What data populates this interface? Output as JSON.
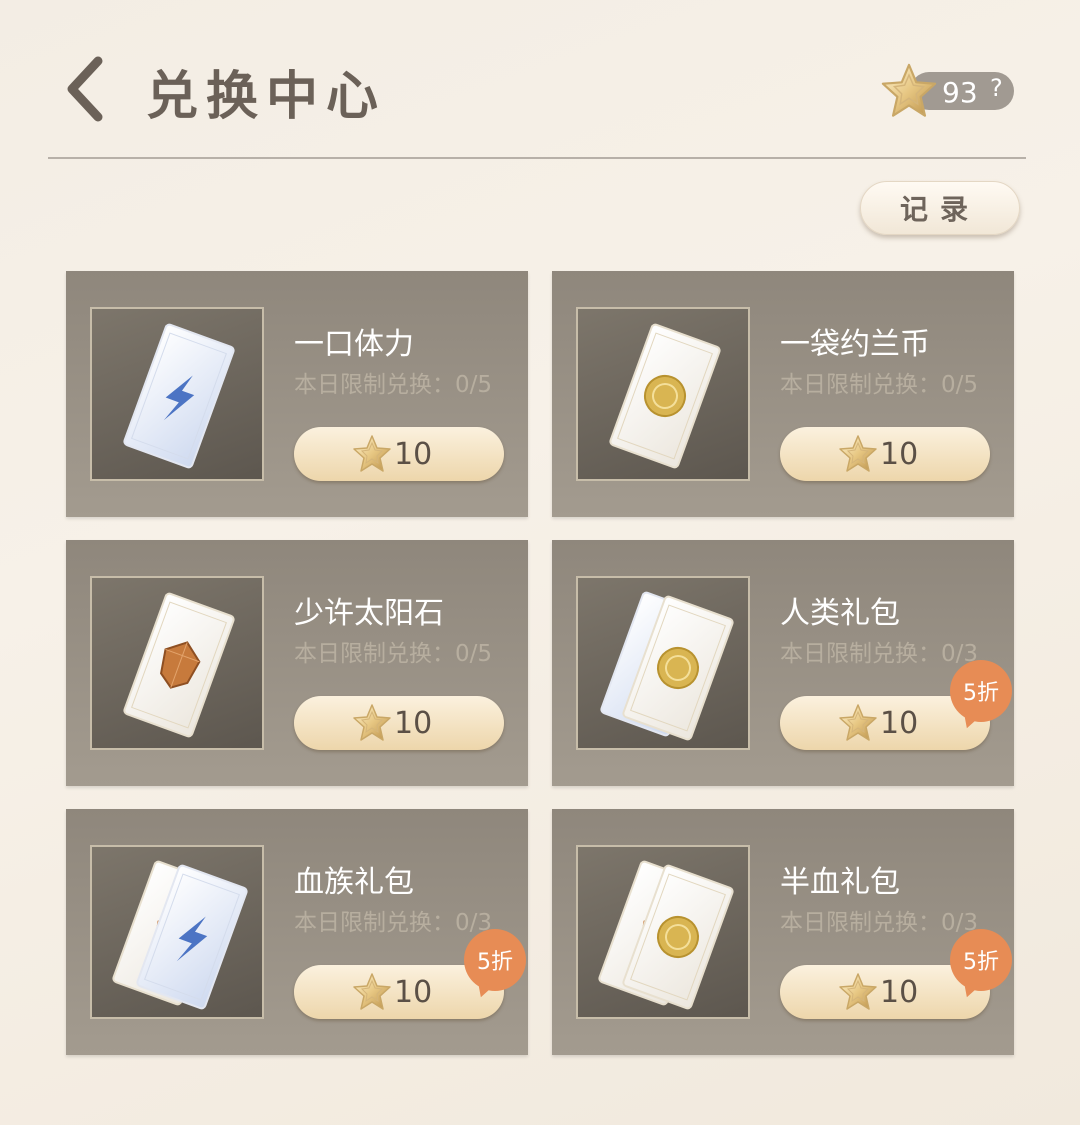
{
  "header": {
    "title": "兑换中心",
    "currency_count": "93",
    "help_label": "?"
  },
  "record_label": "记录",
  "colors": {
    "card_bg": "#978f84",
    "button_gold": "#efd9b0",
    "discount_badge": "#e78c55",
    "title_text": "#6b6158"
  },
  "items": [
    {
      "name": "一口体力",
      "limit": "本日限制兑换：0/5",
      "price": "10",
      "discount": "",
      "icon": "blue-lightning-ticket-icon"
    },
    {
      "name": "一袋约兰币",
      "limit": "本日限制兑换：0/5",
      "price": "10",
      "discount": "",
      "icon": "gold-coin-ticket-icon"
    },
    {
      "name": "少许太阳石",
      "limit": "本日限制兑换：0/5",
      "price": "10",
      "discount": "",
      "icon": "sunstone-ticket-icon"
    },
    {
      "name": "人类礼包",
      "limit": "本日限制兑换：0/3",
      "price": "10",
      "discount": "5折",
      "icon": "lightning-coin-tickets-icon"
    },
    {
      "name": "血族礼包",
      "limit": "本日限制兑换：0/3",
      "price": "10",
      "discount": "5折",
      "icon": "sunstone-lightning-tickets-icon"
    },
    {
      "name": "半血礼包",
      "limit": "本日限制兑换：0/3",
      "price": "10",
      "discount": "5折",
      "icon": "sunstone-coin-tickets-icon"
    }
  ]
}
